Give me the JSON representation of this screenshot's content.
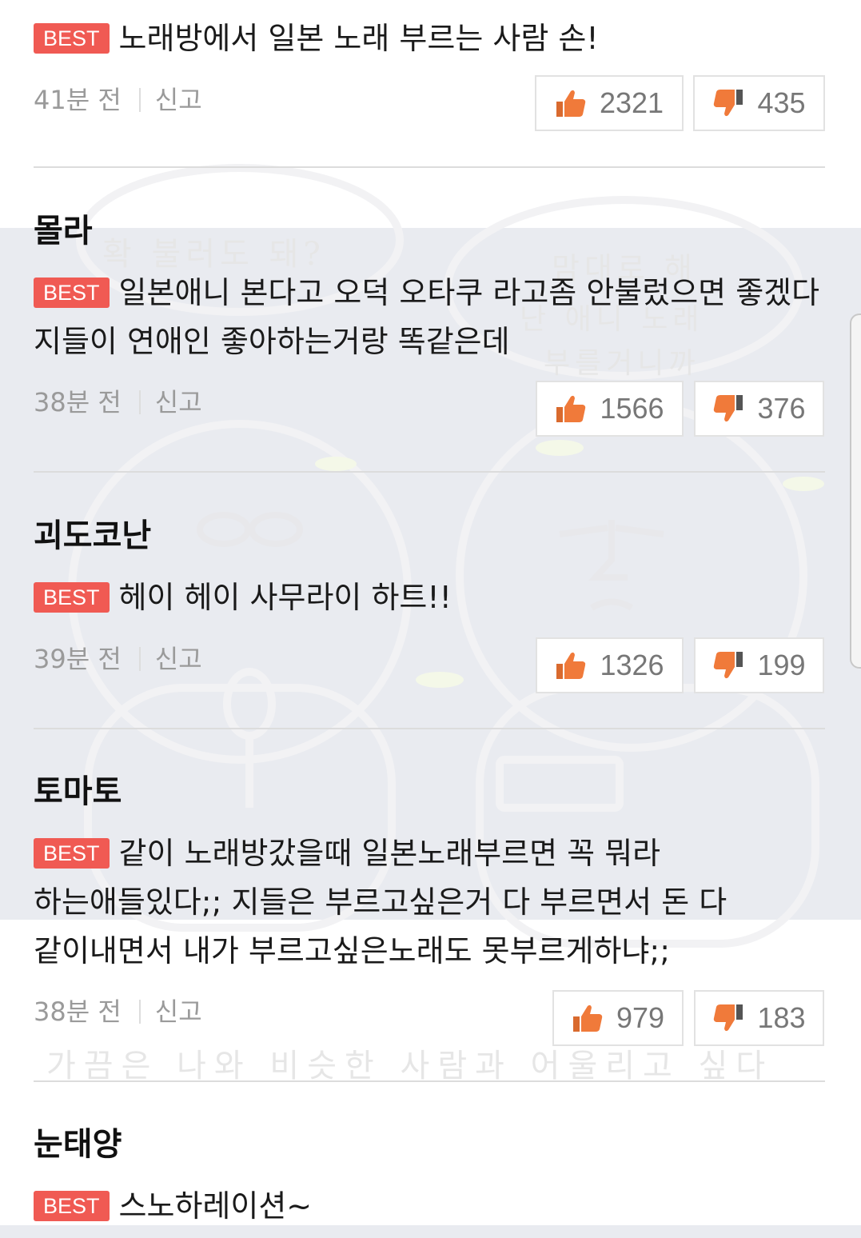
{
  "best_label": "BEST",
  "report_label": "신고",
  "comments": [
    {
      "username": "",
      "text": "노래방에서 일본 노래 부르는 사람 손!",
      "time": "41분 전",
      "likes": "2321",
      "dislikes": "435"
    },
    {
      "username": "몰라",
      "text": "일본애니 본다고 오덕 오타쿠 라고좀 안불렀으면 좋겠다 지들이 연애인 좋아하는거랑 똑같은데",
      "time": "38분 전",
      "likes": "1566",
      "dislikes": "376"
    },
    {
      "username": "괴도코난",
      "text": "헤이 헤이 사무라이 하트!!",
      "time": "39분 전",
      "likes": "1326",
      "dislikes": "199"
    },
    {
      "username": "토마토",
      "text": "같이 노래방갔을때 일본노래부르면 꼭 뭐라 하는애들있다;; 지들은 부르고싶은거 다 부르면서 돈 다 같이내면서 내가 부르고싶은노래도 못부르게하냐;;",
      "time": "38분 전",
      "likes": "979",
      "dislikes": "183"
    },
    {
      "username": "눈태양",
      "text": "스노하레이션~"
    }
  ],
  "watermark": {
    "line1": "확 불러도 돼?",
    "line2": "맘대로 해",
    "line3": "난 애니 노래",
    "line4": "부를거니까",
    "line5": "가끔은 나와 비슷한 사람과 어울리고 싶다"
  },
  "colors": {
    "best_badge": "#f05a53",
    "like_icon": "#f07a3a",
    "divider": "#dcdcdc",
    "background_band": "#e9ebf0"
  },
  "icons": {
    "like": "thumbs-up-icon",
    "dislike": "thumbs-down-icon"
  }
}
